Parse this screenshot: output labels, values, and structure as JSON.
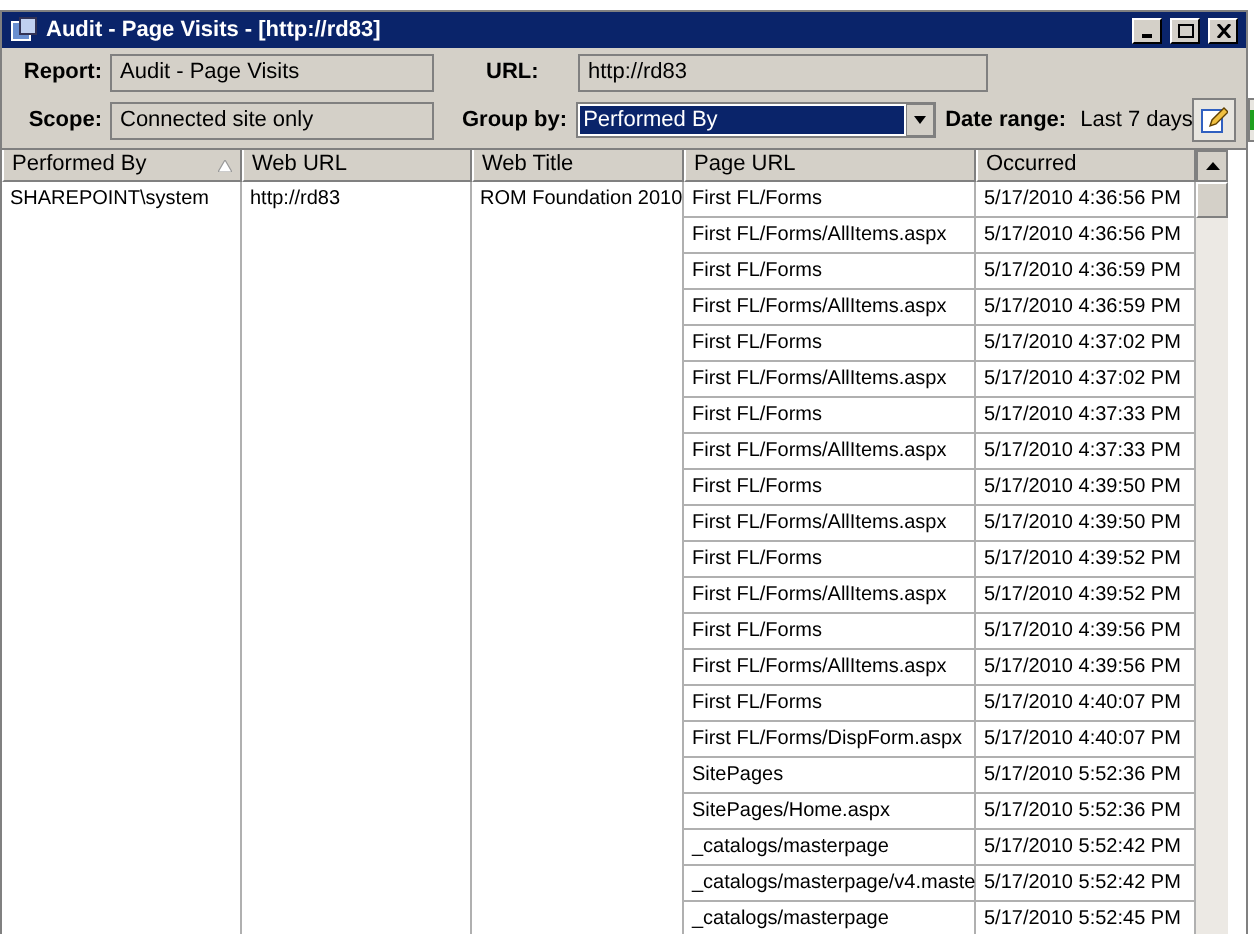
{
  "window": {
    "title": "Audit - Page Visits - [http://rd83]"
  },
  "form": {
    "report_label": "Report:",
    "report": "Audit - Page Visits",
    "url_label": "URL:",
    "url": "http://rd83",
    "scope_label": "Scope:",
    "scope": "Connected site only",
    "group_by_label": "Group by:",
    "group_by": "Performed By",
    "date_range_label": "Date range:",
    "date_range": "Last 7 days"
  },
  "table": {
    "columns": [
      {
        "label": "Performed By",
        "sorted": true
      },
      {
        "label": "Web URL",
        "sorted": false
      },
      {
        "label": "Web Title",
        "sorted": false
      },
      {
        "label": "Page URL",
        "sorted": false
      },
      {
        "label": "Occurred",
        "sorted": false
      }
    ],
    "rows": [
      {
        "performed_by": "SHAREPOINT\\system",
        "web_url": "http://rd83",
        "web_title": "ROM Foundation 2010",
        "page_url": "First FL/Forms",
        "occurred": "5/17/2010 4:36:56 PM"
      },
      {
        "page_url": "First FL/Forms/AllItems.aspx",
        "occurred": "5/17/2010 4:36:56 PM"
      },
      {
        "page_url": "First FL/Forms",
        "occurred": "5/17/2010 4:36:59 PM"
      },
      {
        "page_url": "First FL/Forms/AllItems.aspx",
        "occurred": "5/17/2010 4:36:59 PM"
      },
      {
        "page_url": "First FL/Forms",
        "occurred": "5/17/2010 4:37:02 PM"
      },
      {
        "page_url": "First FL/Forms/AllItems.aspx",
        "occurred": "5/17/2010 4:37:02 PM"
      },
      {
        "page_url": "First FL/Forms",
        "occurred": "5/17/2010 4:37:33 PM"
      },
      {
        "page_url": "First FL/Forms/AllItems.aspx",
        "occurred": "5/17/2010 4:37:33 PM"
      },
      {
        "page_url": "First FL/Forms",
        "occurred": "5/17/2010 4:39:50 PM"
      },
      {
        "page_url": "First FL/Forms/AllItems.aspx",
        "occurred": "5/17/2010 4:39:50 PM"
      },
      {
        "page_url": "First FL/Forms",
        "occurred": "5/17/2010 4:39:52 PM"
      },
      {
        "page_url": "First FL/Forms/AllItems.aspx",
        "occurred": "5/17/2010 4:39:52 PM"
      },
      {
        "page_url": "First FL/Forms",
        "occurred": "5/17/2010 4:39:56 PM"
      },
      {
        "page_url": "First FL/Forms/AllItems.aspx",
        "occurred": "5/17/2010 4:39:56 PM"
      },
      {
        "page_url": "First FL/Forms",
        "occurred": "5/17/2010 4:40:07 PM"
      },
      {
        "page_url": "First FL/Forms/DispForm.aspx",
        "occurred": "5/17/2010 4:40:07 PM"
      },
      {
        "page_url": "SitePages",
        "occurred": "5/17/2010 5:52:36 PM"
      },
      {
        "page_url": "SitePages/Home.aspx",
        "occurred": "5/17/2010 5:52:36 PM"
      },
      {
        "page_url": "_catalogs/masterpage",
        "occurred": "5/17/2010 5:52:42 PM"
      },
      {
        "page_url": "_catalogs/masterpage/v4.maste",
        "occurred": "5/17/2010 5:52:42 PM"
      },
      {
        "page_url": "_catalogs/masterpage",
        "occurred": "5/17/2010 5:52:45 PM"
      }
    ]
  }
}
